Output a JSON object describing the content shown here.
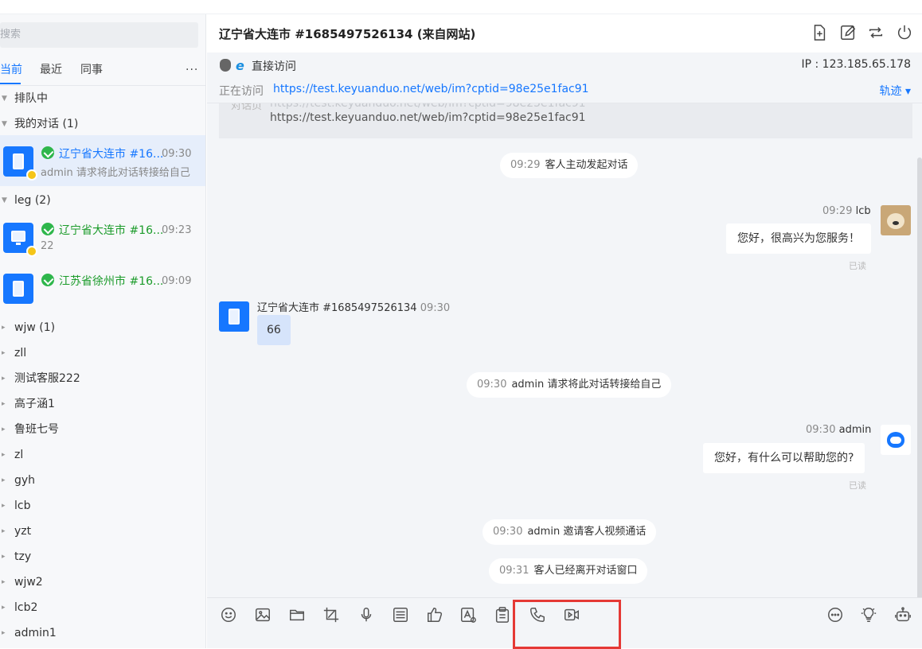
{
  "sidebar": {
    "search_placeholder": "搜索",
    "tabs": [
      "当前",
      "最近",
      "同事"
    ],
    "more": "···",
    "groups": [
      {
        "label": "排队中"
      },
      {
        "label": "我的对话 (1)"
      },
      {
        "label": "leg (2)"
      },
      {
        "label": "wjw (1)"
      },
      {
        "label": "zll"
      },
      {
        "label": "测试客服222"
      },
      {
        "label": "高子涵1"
      },
      {
        "label": "鲁班七号"
      },
      {
        "label": "zl"
      },
      {
        "label": "gyh"
      },
      {
        "label": "lcb"
      },
      {
        "label": "yzt"
      },
      {
        "label": "tzy"
      },
      {
        "label": "wjw2"
      },
      {
        "label": "lcb2"
      },
      {
        "label": "admin1"
      }
    ],
    "conversations": [
      {
        "title": "辽宁省大连市 #16...",
        "time": "09:30",
        "sub": "admin 请求将此对话转接给自己"
      },
      {
        "title": "辽宁省大连市 #16...",
        "time": "09:23",
        "sub": "22"
      },
      {
        "title": "江苏省徐州市 #16...",
        "time": "09:09",
        "sub": ""
      }
    ]
  },
  "header": {
    "title": "辽宁省大连市 #1685497526134 (来自网站)"
  },
  "info": {
    "access": "直接访问",
    "ip": "IP : 123.185.65.178",
    "visiting_label": "正在访问",
    "visiting_url": "https://test.keyuanduo.net/web/im?cptid=98e25e1fac91",
    "trace": "轨迹 ▾",
    "ref_label": "对话页",
    "ref_url_faded": "https://test.keyuanduo.net/web/im?cptid=98e25e1fac91",
    "ref_url": "https://test.keyuanduo.net/web/im?cptid=98e25e1fac91"
  },
  "messages": {
    "sys1": {
      "time": "09:29",
      "text": "客人主动发起对话"
    },
    "agent1": {
      "time": "09:29",
      "name": "lcb",
      "text": "您好，很高兴为您服务！",
      "status": "已读"
    },
    "visitor1": {
      "name": "辽宁省大连市 #1685497526134",
      "time": "09:30",
      "text": "66"
    },
    "sys2": {
      "time": "09:30",
      "text": "admin 请求将此对话转接给自己"
    },
    "agent2": {
      "time": "09:30",
      "name": "admin",
      "text": "您好，有什么可以帮助您的?",
      "status": "已读"
    },
    "sys3": {
      "time": "09:30",
      "text": "admin 邀请客人视频通话"
    },
    "sys4": {
      "time": "09:31",
      "text": "客人已经离开对话窗口"
    }
  },
  "toolbar": {
    "icons": [
      "emoji-icon",
      "image-icon",
      "folder-icon",
      "screenshot-icon",
      "microphone-icon",
      "quick-reply-icon",
      "thumbs-up-icon",
      "translate-icon",
      "clipboard-icon",
      "phone-icon",
      "video-icon",
      "comment-icon",
      "bulb-icon",
      "robot-icon"
    ]
  }
}
